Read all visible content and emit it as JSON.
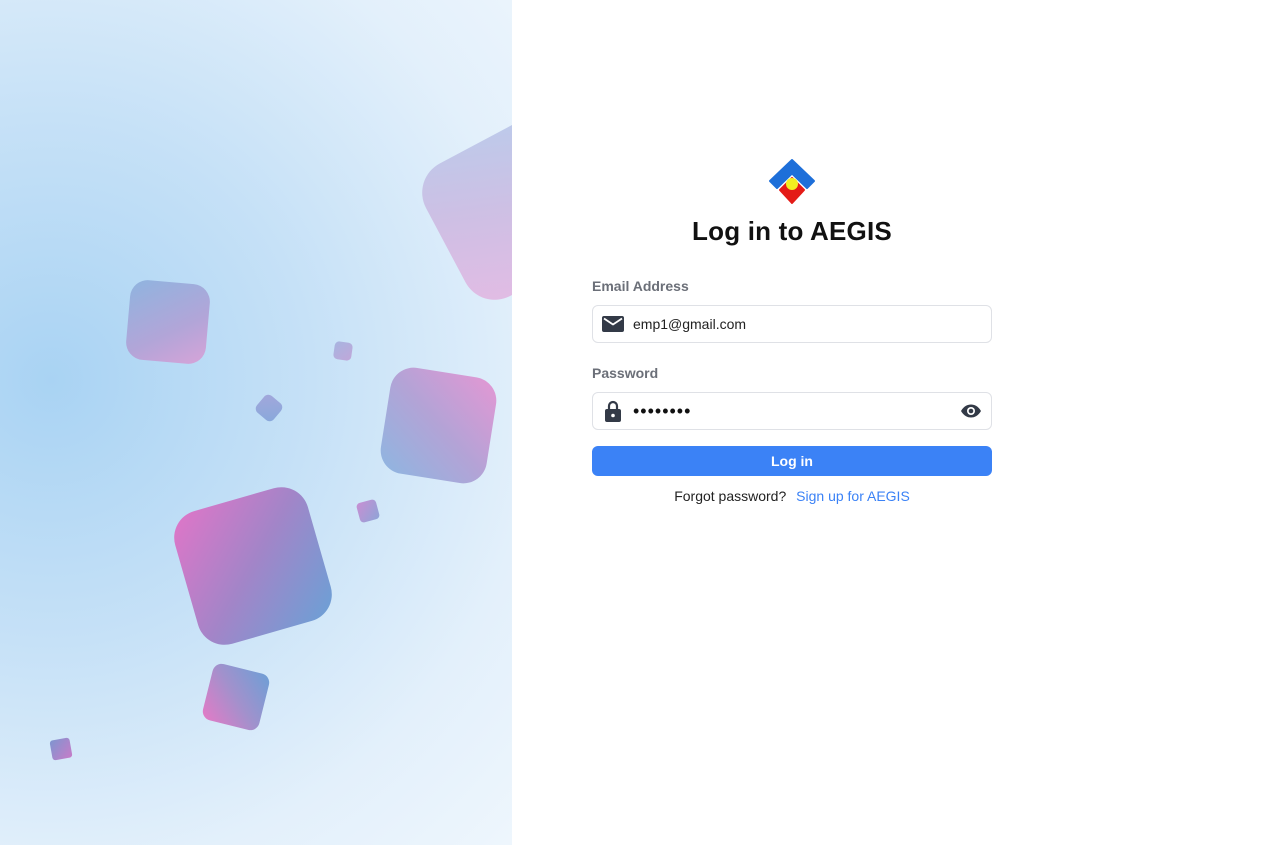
{
  "page": {
    "title": "Log in to AEGIS"
  },
  "logo": {
    "icon": "aegis-logo",
    "colors": {
      "blue": "#1e6fd9",
      "red": "#e41b17",
      "yellow": "#f2ee20"
    }
  },
  "form": {
    "email": {
      "label": "Email Address",
      "value": "emp1@gmail.com",
      "icon": "envelope-icon"
    },
    "password": {
      "label": "Password",
      "value": "••••••••",
      "icon": "lock-icon",
      "toggle_icon": "eye-icon"
    },
    "submit_label": "Log in",
    "forgot_label": "Forgot password?",
    "signup_label": "Sign up for AEGIS"
  },
  "colors": {
    "accent": "#3b82f6",
    "label": "#6b6f78",
    "border": "#dfe1e6"
  }
}
